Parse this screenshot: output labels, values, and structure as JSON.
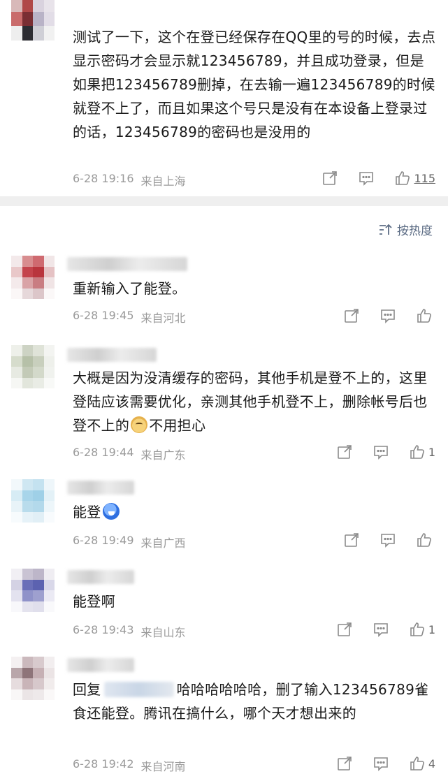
{
  "top_comment": {
    "text": "测试了一下，这个在登已经保存在QQ里的号的时候，去点显示密码才会显示就123456789，并且成功登录，但是如果把123456789删掉，在去输一遍123456789的时候就登不上了，而且如果这个号只是没有在本设备上登录过的话，123456789的密码也是没用的",
    "date": "6-28 19:16",
    "location": "来自上海",
    "likes": "115"
  },
  "sort": {
    "label": "按热度"
  },
  "comments": [
    {
      "text": "重新输入了能登。",
      "date": "6-28 19:45",
      "location": "来自河北",
      "likes": ""
    },
    {
      "text": "大概是因为没清缓存的密码，其他手机是登不上的，这里登陆应该需要优化，亲测其他手机登不上，删除帐号后也登不上的",
      "text_after": "不用担心",
      "date": "6-28 19:44",
      "location": "来自广东",
      "likes": "1"
    },
    {
      "text": "能登",
      "date": "6-28 19:49",
      "location": "来自广西",
      "likes": ""
    },
    {
      "text": "能登啊",
      "date": "6-28 19:43",
      "location": "来自山东",
      "likes": "1"
    },
    {
      "reply_prefix": "回复",
      "text": "哈哈哈哈哈哈，删了输入123456789雀食还能登。腾讯在搞什么，哪个天才想出来的",
      "date": "6-28 19:42",
      "location": "来自河南",
      "likes": "4"
    }
  ],
  "icons": [
    "share-icon",
    "comment-icon",
    "like-icon",
    "sort-icon",
    "doge-emoji",
    "laugh-emoji"
  ]
}
